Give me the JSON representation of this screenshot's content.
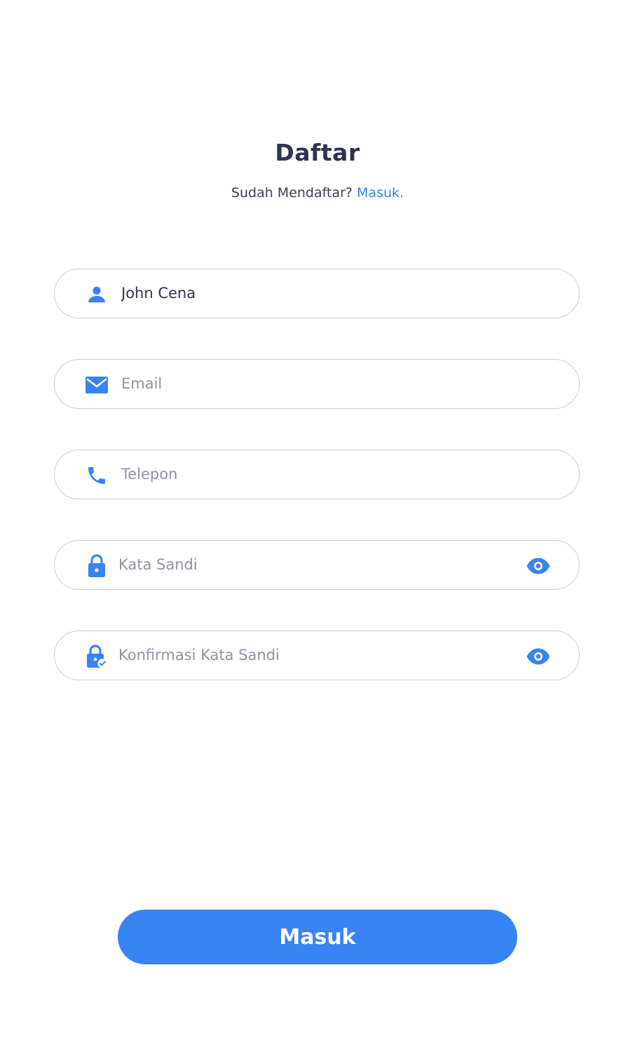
{
  "header": {
    "title": "Daftar",
    "subtitle_text": "Sudah Mendaftar?",
    "subtitle_link": "Masuk."
  },
  "form": {
    "name": {
      "value": "John Cena",
      "placeholder": "",
      "icon": "user-icon"
    },
    "email": {
      "value": "",
      "placeholder": "Email",
      "icon": "mail-icon"
    },
    "phone": {
      "value": "",
      "placeholder": "Telepon",
      "icon": "phone-icon"
    },
    "password": {
      "value": "",
      "placeholder": "Kata Sandi",
      "icon": "lock-icon",
      "toggle_icon": "eye-icon"
    },
    "confirm_password": {
      "value": "",
      "placeholder": "Konfirmasi Kata Sandi",
      "icon": "lock-check-icon",
      "toggle_icon": "eye-icon"
    }
  },
  "submit": {
    "label": "Masuk"
  },
  "colors": {
    "accent": "#3884f4",
    "text_dark": "#2e3450",
    "placeholder": "#8e94a6",
    "border": "#c9cfdd"
  }
}
